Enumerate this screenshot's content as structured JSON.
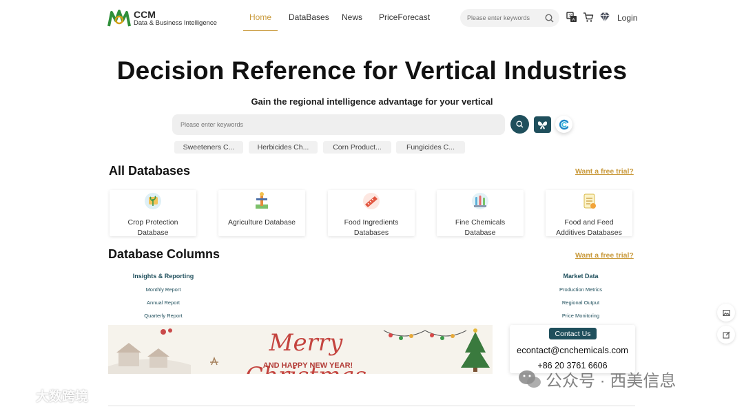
{
  "header": {
    "logo_title": "CCM",
    "logo_subtitle": "Data & Business Intelligence",
    "nav": [
      {
        "label": "Home",
        "active": true
      },
      {
        "label": "DataBases"
      },
      {
        "label": "News"
      },
      {
        "label": "PriceForecast"
      }
    ],
    "search_placeholder": "Please enter keywords",
    "login_label": "Login",
    "icons": [
      "translate-icon",
      "cart-icon",
      "diamond-icon"
    ],
    "accent_color": "#c99a3c",
    "brand_color": "#1f4f5c"
  },
  "hero": {
    "title": "Decision Reference for Vertical Industries",
    "subtitle": "Gain the regional intelligence advantage for your vertical",
    "search_placeholder": "Please enter keywords",
    "chips": [
      "Sweeteners C...",
      "Herbicides Ch...",
      "Corn Product...",
      "Fungicides C..."
    ]
  },
  "all_databases": {
    "title": "All Databases",
    "trial_link": "Want a free trial?",
    "cards": [
      {
        "line1": "Crop Protection",
        "line2": "Database",
        "icon": "crop-protection-icon"
      },
      {
        "line1": "Agriculture Database",
        "line2": "",
        "icon": "agriculture-icon"
      },
      {
        "line1": "Food Ingredients",
        "line2": "Databases",
        "icon": "food-ingredients-icon"
      },
      {
        "line1": "Fine Chemicals",
        "line2": "Database",
        "icon": "fine-chemicals-icon"
      },
      {
        "line1": "Food and Feed",
        "line2": "Additives Databases",
        "icon": "food-feed-icon"
      }
    ]
  },
  "database_columns": {
    "title": "Database Columns",
    "trial_link": "Want a free trial?",
    "insights": {
      "heading": "Insights & Reporting",
      "items": [
        "Monthly Report",
        "Annual Report",
        "Quarterly Report"
      ]
    },
    "market": {
      "heading": "Market Data",
      "items": [
        "Production Metrics",
        "Regional Output",
        "Price Monitoring"
      ]
    }
  },
  "banner": {
    "headline": "Merry Christmas",
    "subline": "AND HAPPY NEW YEAR!"
  },
  "contact": {
    "button_label": "Contact Us",
    "email": "econtact@cnchemicals.com",
    "phone": "+86 20 3761 6606"
  },
  "watermarks": {
    "left": "大数跨境",
    "right": "公众号 · 西美信息"
  }
}
